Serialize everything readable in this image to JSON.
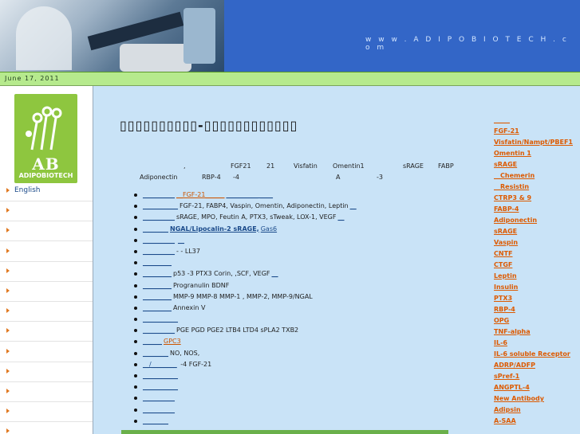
{
  "header": {
    "url": "w w w . A D I P O B I O T E C H . c o m"
  },
  "datebar": {
    "date": "June 17, 2011"
  },
  "logo": {
    "letters": "AB",
    "brand": "ADIPOBIOTECH"
  },
  "sidebar": {
    "items": [
      {
        "label": "English"
      },
      {
        "label": ""
      },
      {
        "label": ""
      },
      {
        "label": ""
      },
      {
        "label": ""
      },
      {
        "label": ""
      },
      {
        "label": ""
      },
      {
        "label": ""
      },
      {
        "label": ""
      },
      {
        "label": ""
      },
      {
        "label": ""
      },
      {
        "label": ""
      },
      {
        "label": ""
      }
    ]
  },
  "main": {
    "title": "▯▯▯▯▯▯▯▯▯▯-▯▯▯▯▯▯▯▯▯▯▯▯",
    "intro1": [
      ",",
      "FGF21",
      "21",
      "Visfatin",
      "Omentin1",
      "sRAGE",
      "FABP"
    ],
    "intro2": [
      "Adiponectin",
      "RBP-4",
      "-4",
      "A",
      "-3"
    ],
    "list": [
      {
        "a": "__________",
        "b": "__FGF-21______",
        "c": "__________ ____"
      },
      {
        "a": "___________",
        "b": "FGF-21, FABP4, Vaspin, Omentin, Adiponectin, Leptin",
        "c": "__"
      },
      {
        "a": "__________",
        "b": "sRAGE, MPO, Feutin A, PTX3, sTweak, LOX-1, VEGF",
        "c": "__"
      },
      {
        "a": "________",
        "b": "NGAL/Lipocalin-2 sRAGE,",
        "c": "Gas6"
      },
      {
        "a": "__________",
        "b": "",
        "c": "__"
      },
      {
        "a": "__________",
        "b": "-       -     LL37",
        "c": ""
      },
      {
        "a": "_________",
        "b": "",
        "c": ""
      },
      {
        "a": "_________",
        "b": "p53      -3 PTX3 Corin,     ,SCF, VEGF",
        "c": "__"
      },
      {
        "a": "_________",
        "b": "Progranulin     BDNF",
        "c": ""
      },
      {
        "a": "_________",
        "b": "MMP-9  MMP-8  MMP-1 , MMP-2, MMP-9/NGAL",
        "c": ""
      },
      {
        "a": "_________",
        "b": "Annexin V",
        "c": ""
      },
      {
        "a": "___________",
        "b": "",
        "c": ""
      },
      {
        "a": "__________",
        "b": "PGE PGD PGE2 LTB4 LTD4 sPLA2  TXB2",
        "c": ""
      },
      {
        "a": "______",
        "b": "GPC3",
        "c": ""
      },
      {
        "a": "________",
        "b": "NO, NOS,",
        "c": ""
      },
      {
        "a": "__/________",
        "b": "              -4 FGF-21",
        "c": ""
      },
      {
        "a": "___________",
        "b": "",
        "c": ""
      },
      {
        "a": "___________",
        "b": "",
        "c": ""
      },
      {
        "a": "__________",
        "b": "",
        "c": ""
      },
      {
        "a": "     __________",
        "b": "",
        "c": ""
      },
      {
        "a": "________",
        "b": "",
        "c": ""
      }
    ]
  },
  "right_nav": {
    "items": [
      "_____",
      "FGF-21",
      "Visfatin/Nampt/PBEF1",
      "Omentin 1",
      "sRAGE",
      "__Chemerin",
      "__Resistin",
      "CTRP3 & 9",
      "FABP-4",
      "Adiponectin",
      "sRAGE",
      "Vaspin",
      "CNTF",
      "CTGF",
      "Leptin",
      "Insulin",
      "PTX3",
      "RBP-4",
      "OPG",
      "TNF-alpha",
      "IL-6",
      "IL-6 soluble Receptor",
      "ADRP/ADFP",
      "sPref-1",
      "ANGPTL-4",
      "New Antibody",
      "Adipsin",
      "A-SAA"
    ]
  },
  "colors": {
    "header_blue": "#3366c7",
    "date_green": "#b6ea8d",
    "page_bg": "#c9e3f7",
    "logo_green": "#8ec63f",
    "link_orange": "#dd5a00"
  }
}
